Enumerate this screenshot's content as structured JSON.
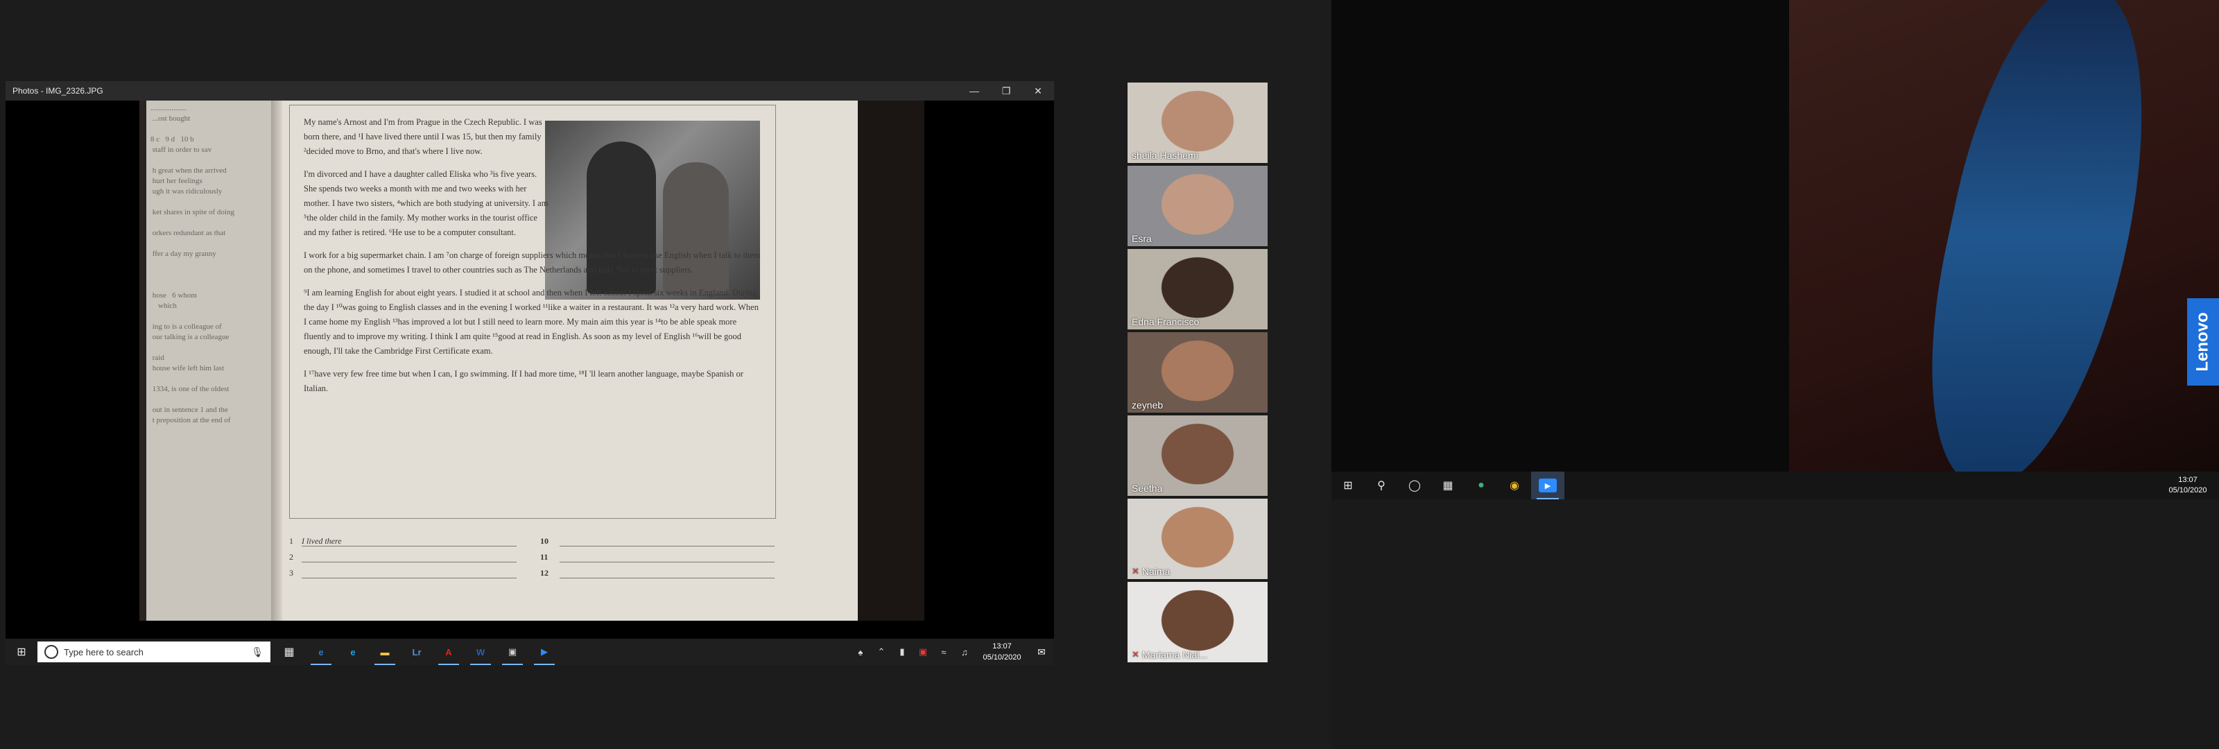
{
  "photos_window": {
    "title": "Photos - IMG_2326.JPG",
    "minimize_icon": "minimize-icon",
    "maximize_icon": "maximize-icon",
    "close_icon": "close-icon"
  },
  "book": {
    "left_page_lines": "...................\n ...ost bought\n\n8 c   9 d   10 b\n staff in order to sav\n\n h great when the arrived\n hurt her feelings\n ugh it was ridiculously\n\n ket shares in spite of doing\n\n orkers redundant as that\n\n ffer a day my granny\n\n\n\n hose   6 whom\n    which\n\n ing to is a colleague of\n our talking is a colleague\n\n raid\n house wife left him last\n\n 1334, is one of the oldest\n\n out in sentence 1 and the\n t preposition at the end of",
    "paragraphs": [
      "My name's Arnost and I'm from Prague in the Czech Republic. I was born there, and ¹I have lived there until I was 15, but then my family ²decided move to Brno, and that's where I live now.",
      "I'm divorced and I have a daughter called Eliska who ³is five years. She spends two weeks a month with me and two weeks with her mother. I have two sisters, ⁴which are both studying at university. I am ⁵the older child in the family. My mother works in the tourist office and my father is retired. ⁶He use to be a computer consultant.",
      "I work for a big supermarket chain. I am ⁷on charge of foreign suppliers which means that I have to use English when I talk to them on the phone, and sometimes I travel to other countries such as The Netherlands and Italy ⁸for to meet suppliers.",
      "⁹I am learning English for about eight years. I studied it at school and then when I left school I spent six weeks in England. During the day I ¹⁰was going to English classes and in the evening I worked ¹¹like a waiter in a restaurant. It was ¹²a very hard work. When I came home my English ¹³has improved a lot but I still need to learn more. My main aim this year is ¹⁴to be able speak more fluently and to improve my writing. I think I am quite ¹⁵good at read in English. As soon as my level of English ¹⁶will be good enough, I'll take the Cambridge First Certificate exam.",
      "I ¹⁷have very few free time but when I can, I go swimming. If I had more time, ¹⁸I 'll learn another language, maybe Spanish or Italian."
    ],
    "answers": [
      {
        "num": "1",
        "text": "I lived there",
        "num2": "10"
      },
      {
        "num": "2",
        "text": "",
        "num2": "11"
      },
      {
        "num": "3",
        "text": "",
        "num2": "12"
      }
    ]
  },
  "share_taskbar": {
    "search_placeholder": "Type here to search",
    "time": "13:07",
    "date": "05/10/2020",
    "apps": [
      {
        "name": "edge-legacy-icon",
        "glyph": "e",
        "color": "#3277bc",
        "active": true
      },
      {
        "name": "internet-explorer-icon",
        "glyph": "e",
        "color": "#1ea0e6",
        "active": false
      },
      {
        "name": "file-explorer-icon",
        "glyph": "▬",
        "color": "#f2c14e",
        "active": true
      },
      {
        "name": "lr-app-icon",
        "glyph": "Lr",
        "color": "#5b8fc9",
        "active": false
      },
      {
        "name": "acrobat-icon",
        "glyph": "A",
        "color": "#e2231a",
        "active": true
      },
      {
        "name": "word-icon",
        "glyph": "W",
        "color": "#2b5fb3",
        "active": true
      },
      {
        "name": "photos-icon",
        "glyph": "▣",
        "color": "#cfcfcf",
        "active": true
      },
      {
        "name": "zoom-icon",
        "glyph": "▶",
        "color": "#2d8cff",
        "active": true
      }
    ]
  },
  "participants": [
    {
      "name": "sheila Hashemi",
      "muted": false,
      "active": true,
      "skin": "#b98d74",
      "bg": "#cfc8bf"
    },
    {
      "name": "Esra",
      "muted": false,
      "active": false,
      "skin": "#c29a83",
      "bg": "#8e8e92"
    },
    {
      "name": "Edna Francisco",
      "muted": false,
      "active": false,
      "skin": "#3b2a22",
      "bg": "#b9b2a6"
    },
    {
      "name": "zeyneb",
      "muted": false,
      "active": false,
      "skin": "#a97a60",
      "bg": "#6e5a4e"
    },
    {
      "name": "Seetha",
      "muted": false,
      "active": false,
      "skin": "#7a5440",
      "bg": "#b4aea6"
    },
    {
      "name": "Naima",
      "muted": true,
      "active": false,
      "skin": "#b88767",
      "bg": "#d7d3cf"
    },
    {
      "name": "Mariama Nial...",
      "muted": true,
      "active": false,
      "skin": "#6a4634",
      "bg": "#e8e6e4"
    }
  ],
  "desktop": {
    "brand": "Lenovo",
    "time": "13:07",
    "date": "05/10/2020",
    "taskbar_icons": [
      "windows-start-icon",
      "search-icon",
      "cortana-icon",
      "task-view-icon",
      "edge-icon",
      "chrome-icon",
      "zoom-icon"
    ]
  }
}
